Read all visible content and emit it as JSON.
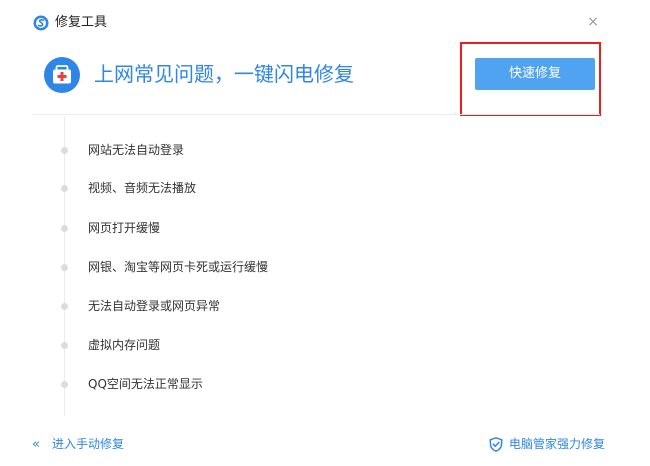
{
  "window": {
    "title": "修复工具",
    "close_glyph": "×"
  },
  "hero": {
    "icon": "first-aid-kit-icon",
    "headline": "上网常见问题，一键闪电修复",
    "button_label": "快速修复"
  },
  "issues": [
    "网站无法自动登录",
    "视频、音频无法播放",
    "网页打开缓慢",
    "网银、淘宝等网页卡死或运行缓慢",
    "无法自动登录或网页异常",
    "虚拟内存问题",
    "QQ空间无法正常显示"
  ],
  "footer": {
    "manual_icon": "double-chevron-left-icon",
    "manual_label": "进入手动修复",
    "guard_icon": "shield-icon",
    "guard_label": "电脑管家强力修复"
  },
  "colors": {
    "accent": "#2f86e6",
    "button": "#4fa3f1",
    "highlight": "#e8211f",
    "kit": "#2f86e6"
  }
}
